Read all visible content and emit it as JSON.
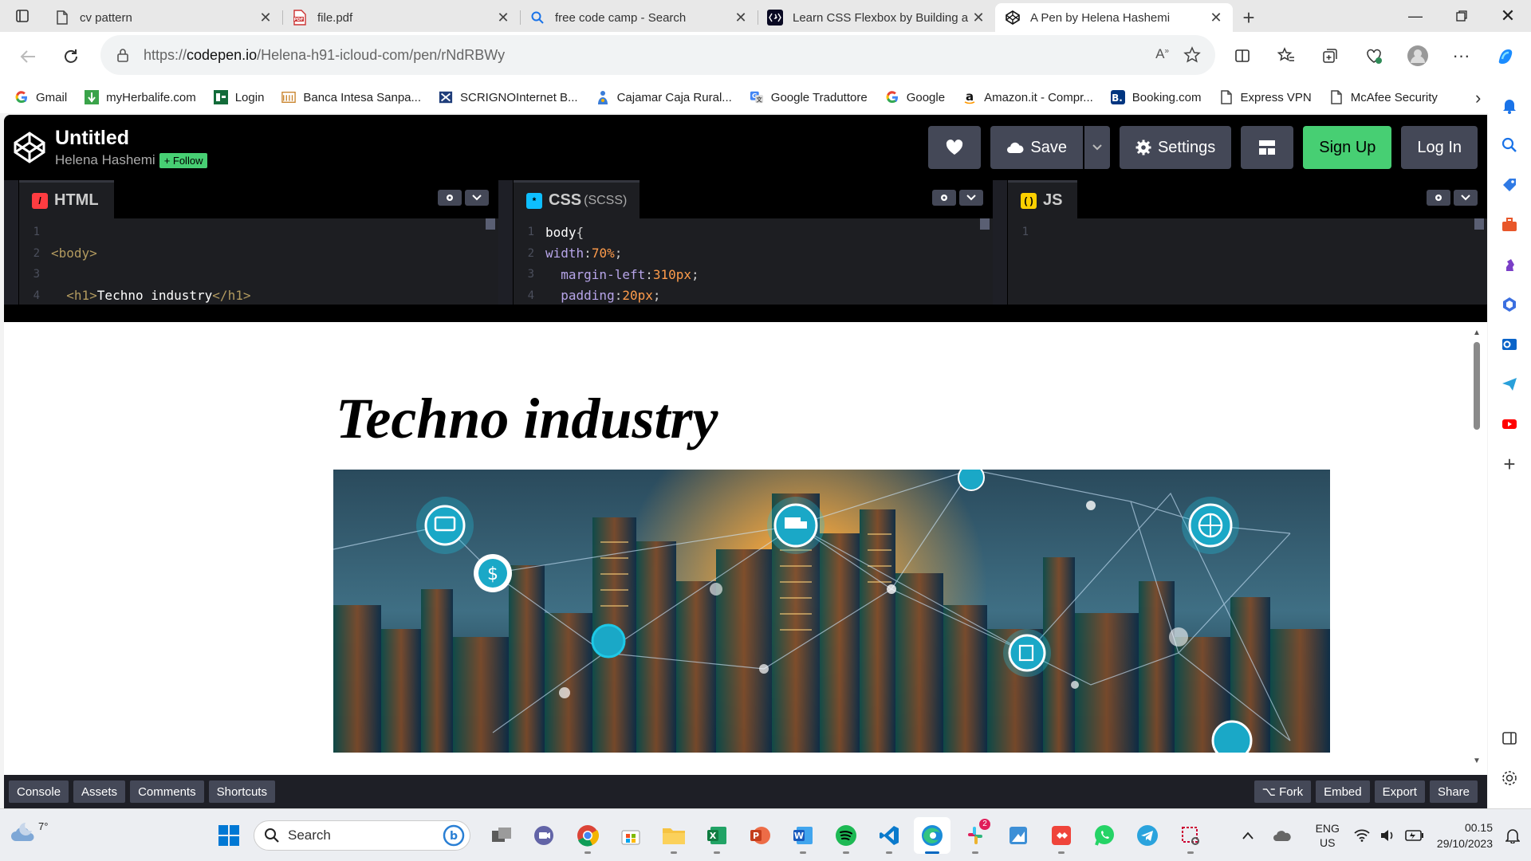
{
  "browser": {
    "tabs": [
      {
        "title": "cv pattern",
        "icon": "page-icon"
      },
      {
        "title": "file.pdf",
        "icon": "pdf-icon"
      },
      {
        "title": "free code camp - Search",
        "icon": "search-icon"
      },
      {
        "title": "Learn CSS Flexbox by Building a P",
        "icon": "freecodecamp-icon"
      },
      {
        "title": "A Pen by Helena Hashemi",
        "icon": "codepen-icon",
        "active": true
      }
    ],
    "url_prefix": "https://",
    "url_domain": "codepen.io",
    "url_path": "/Helena-h91-icloud-com/pen/rNdRBWy",
    "bookmarks": [
      {
        "label": "Gmail",
        "icon": "google-icon",
        "color": "#4285f4"
      },
      {
        "label": "myHerbalife.com",
        "icon": "herbalife-icon",
        "color": "#2e8b3a"
      },
      {
        "label": "Login",
        "icon": "login-icon",
        "color": "#1b7a3d"
      },
      {
        "label": "Banca Intesa Sanpa...",
        "icon": "bank-icon",
        "color": "#c9832b"
      },
      {
        "label": "SCRIGNOInternet B...",
        "icon": "scrigno-icon",
        "color": "#1f3d7a"
      },
      {
        "label": "Cajamar Caja Rural...",
        "icon": "cajamar-icon",
        "color": "#3b7dd8"
      },
      {
        "label": "Google Traduttore",
        "icon": "translate-icon",
        "color": "#4285f4"
      },
      {
        "label": "Google",
        "icon": "google-icon",
        "color": "#4285f4"
      },
      {
        "label": "Amazon.it - Compr...",
        "icon": "amazon-icon",
        "color": "#111"
      },
      {
        "label": "Booking.com",
        "icon": "booking-icon",
        "color": "#003580"
      },
      {
        "label": "Express VPN",
        "icon": "page-icon",
        "color": "#444"
      },
      {
        "label": "McAfee Security",
        "icon": "page-icon",
        "color": "#444"
      }
    ]
  },
  "codepen": {
    "title": "Untitled",
    "author": "Helena Hashemi",
    "follow_label": "+ Follow",
    "actions": {
      "save": "Save",
      "settings": "Settings",
      "signup": "Sign Up",
      "login": "Log In"
    },
    "editors": [
      {
        "name": "HTML",
        "sub": "",
        "badge_color": "#ff3c41",
        "lines": [
          {
            "n": "1",
            "html": ""
          },
          {
            "n": "2",
            "html": "<span class='c-tag'>&lt;body&gt;</span>"
          },
          {
            "n": "3",
            "html": ""
          },
          {
            "n": "4",
            "html": "&nbsp;&nbsp;<span class='c-tag'>&lt;h1&gt;</span><span class='c-text'>Techno industry</span><span class='c-tag'>&lt;/h1&gt;</span>"
          }
        ]
      },
      {
        "name": "CSS",
        "sub": "(SCSS)",
        "badge_color": "#0ebeff",
        "lines": [
          {
            "n": "1",
            "html": "<span class='c-sel'>body</span><span class='c-punct'>{</span>"
          },
          {
            "n": "2",
            "html": "<span class='c-prop'>width</span><span class='c-punct'>:</span><span class='c-num'>70%</span><span class='c-punct'>;</span>"
          },
          {
            "n": "3",
            "html": "&nbsp;&nbsp;<span class='c-prop'>margin-left</span><span class='c-punct'>:</span><span class='c-num'>310px</span><span class='c-punct'>;</span>"
          },
          {
            "n": "4",
            "html": "&nbsp;&nbsp;<span class='c-prop'>padding</span><span class='c-punct'>:</span><span class='c-num'>20px</span><span class='c-punct'>;</span>"
          }
        ]
      },
      {
        "name": "JS",
        "sub": "",
        "badge_color": "#fcd000",
        "lines": [
          {
            "n": "1",
            "html": ""
          }
        ]
      }
    ],
    "preview_heading": "Techno industry",
    "footer_left": [
      "Console",
      "Assets",
      "Comments",
      "Shortcuts"
    ],
    "footer_right": [
      "⌥ Fork",
      "Embed",
      "Export",
      "Share"
    ]
  },
  "taskbar": {
    "weather_temp": "7°",
    "search_placeholder": "Search",
    "lang_line1": "ENG",
    "lang_line2": "US",
    "time": "00.15",
    "date": "29/10/2023",
    "slack_badge": "2"
  },
  "colors": {
    "accent_green": "#47cf73",
    "codepen_dark": "#1e1f26",
    "edge_blue": "#0067c0"
  }
}
